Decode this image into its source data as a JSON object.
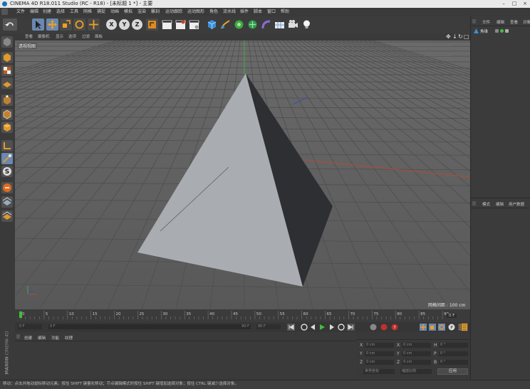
{
  "window": {
    "title": "CINEMA 4D R18.011 Studio (RC - R18) - [未标题 1 *] - 主要"
  },
  "menu": [
    "文件",
    "编辑",
    "创建",
    "选择",
    "工具",
    "网格",
    "捕捉",
    "动画",
    "模拟",
    "渲染",
    "雕刻",
    "运动跟踪",
    "运动图形",
    "角色",
    "流水线",
    "插件",
    "脚本",
    "窗口",
    "帮助"
  ],
  "toolbar": {
    "axis_x": "X",
    "axis_y": "Y",
    "axis_z": "Z"
  },
  "viewport": {
    "menu": [
      "查看",
      "摄像机",
      "显示",
      "选项",
      "过滤",
      "面板"
    ],
    "label": "透视视图",
    "grid_info": "网格间距 : 100 cm",
    "colors": {
      "bg": "#5e5e5e",
      "face_light": "#a9adb1",
      "face_dark": "#2d2f33",
      "x_axis": "#b44a3a",
      "y_axis": "#3fae3f",
      "z_axis": "#3a4fb0"
    }
  },
  "timeline": {
    "ticks": [
      "0",
      "5",
      "10",
      "15",
      "20",
      "25",
      "30",
      "35",
      "40",
      "45",
      "50",
      "55",
      "60",
      "65",
      "70",
      "75",
      "80",
      "85",
      "90"
    ],
    "current_field": "0 F"
  },
  "playbar": {
    "start": "0 F",
    "min": "0 F",
    "max": "90 F",
    "end": "90 F"
  },
  "bottom_left": {
    "tabs": [
      "创建",
      "编辑",
      "功能",
      "纹理"
    ]
  },
  "coords": {
    "rows": [
      {
        "a": "X",
        "av": "0 cm",
        "b": "X",
        "bv": "0 cm",
        "c": "H",
        "cv": "0 °"
      },
      {
        "a": "Y",
        "av": "0 cm",
        "b": "Y",
        "bv": "0 cm",
        "c": "P",
        "cv": "0 °"
      },
      {
        "a": "Z",
        "av": "0 cm",
        "b": "Z",
        "bv": "0 cm",
        "c": "B",
        "cv": "0 °"
      }
    ],
    "mode1": "世界坐标",
    "mode2": "缩放比例",
    "apply": "应用"
  },
  "objects_panel": {
    "tabs": [
      "文件",
      "编辑",
      "查看",
      "对象"
    ],
    "items": [
      {
        "name": "角锥"
      }
    ]
  },
  "attributes_panel": {
    "tabs": [
      "模式",
      "编辑",
      "用户数据"
    ]
  },
  "statusbar": {
    "text": "移动：点击并拖动鼠标移动元素。按住 SHIFT 键量化移动；节点编辑模式时按住 SHIFT 键增加选择对象；按住 CTRL 键减少选择对象。"
  },
  "brand": {
    "line1": "MAXON",
    "line2": "CINEMA 4D"
  }
}
